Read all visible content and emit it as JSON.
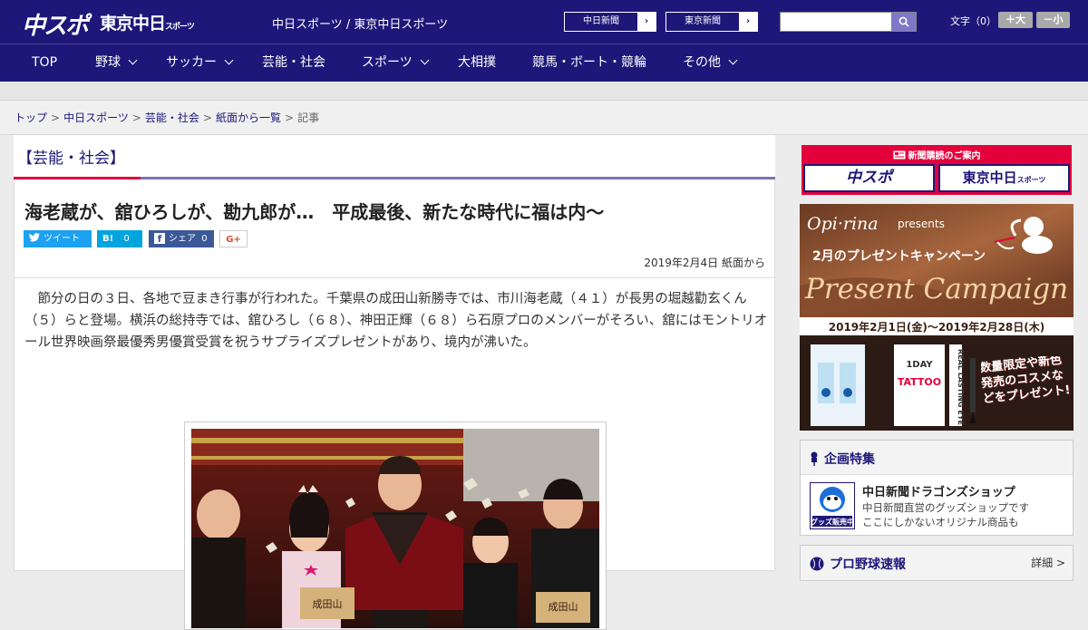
{
  "header": {
    "logo_chuspo": "中スポ",
    "logo_tokyo": "東京中日",
    "logo_tokyo_sub": "スポーツ",
    "site_title": "中日スポーツ / 東京中日スポーツ",
    "link_chunichi": "中日新聞",
    "link_tokyo": "東京新聞",
    "search_placeholder": "",
    "fontsize_label": "文字（0）",
    "font_larger": "＋大",
    "font_smaller": "－小"
  },
  "nav": {
    "items": [
      {
        "label": "TOP",
        "has_dropdown": false
      },
      {
        "label": "野球",
        "has_dropdown": true
      },
      {
        "label": "サッカー",
        "has_dropdown": true
      },
      {
        "label": "芸能・社会",
        "has_dropdown": false
      },
      {
        "label": "スポーツ",
        "has_dropdown": true
      },
      {
        "label": "大相撲",
        "has_dropdown": false
      },
      {
        "label": "競馬・ボート・競輪",
        "has_dropdown": false
      },
      {
        "label": "その他",
        "has_dropdown": true
      }
    ]
  },
  "breadcrumb": {
    "items": [
      "トップ",
      "中日スポーツ",
      "芸能・社会",
      "紙面から一覧"
    ],
    "current": "記事",
    "separator": ">"
  },
  "article": {
    "category": "【芸能・社会】",
    "headline": "海老蔵が、舘ひろしが、勘九郎が…　平成最後、新たな時代に福は内～",
    "share": {
      "tweet": "ツイート",
      "hatena_label": "B!",
      "hatena_count": "0",
      "fb_label": "シェア",
      "fb_count": "0",
      "gplus": "G+"
    },
    "date": "2019年2月4日 紙面から",
    "body": "節分の日の３日、各地で豆まき行事が行われた。千葉県の成田山新勝寺では、市川海老蔵（４１）が長男の堀越勸玄くん（５）らと登場。横浜の総持寺では、舘ひろし（６８）、神田正輝（６８）ら石原プロのメンバーがそろい、舘にはモントリオール世界映画祭最優秀男優賞受賞を祝うサプライズプレゼントがあり、境内が沸いた。",
    "photo_sign_1": "成田山",
    "photo_sign_2": "成田山"
  },
  "sidebar": {
    "subscribe_title": "新聞購読のご案内",
    "subscribe_chuspo": "中スポ",
    "subscribe_tokyo": "東京中日",
    "subscribe_tokyo_sub": "スポーツ",
    "ad": {
      "brand": "Opi·rina",
      "presents": "presents",
      "headline": "2月のプレゼントキャンペーン",
      "script": "Present Campaign",
      "dates": "2019年2月1日(金)～2019年2月28日(木)",
      "tattoo_1day": "1DAY",
      "tattoo": "TATTOO",
      "eyeliner_text": "REAL LASTING EYE",
      "promo": "数量限定や新色発売のコスメなどをプレゼント!"
    },
    "special": {
      "title": "企画特集",
      "item_title": "中日新聞ドラゴンズショップ",
      "item_desc_1": "中日新聞直営のグッズショップです",
      "item_desc_2": "ここにしかないオリジナル商品も",
      "badge_text": "グッズ販売中"
    },
    "baseball": {
      "title": "プロ野球速報",
      "detail": "詳細 >"
    }
  },
  "colors": {
    "brand_navy": "#1d1779",
    "accent_red": "#e4003b",
    "twitter": "#1da1f2",
    "hatena": "#00a4de",
    "facebook": "#3b5998"
  }
}
